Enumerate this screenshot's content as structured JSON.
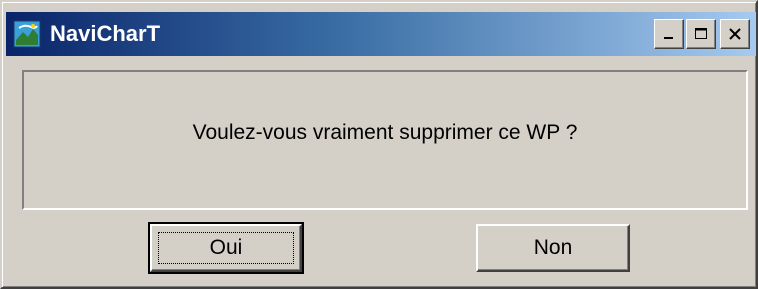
{
  "window": {
    "title": "NaviCharT",
    "icon": "navichart-app-icon",
    "controls": [
      "minimize-icon",
      "maximize-icon",
      "close-icon"
    ]
  },
  "dialog": {
    "message": "Voulez-vous vraiment supprimer ce WP ?"
  },
  "buttons": {
    "yes_label": "Oui",
    "no_label": "Non",
    "default": "yes"
  },
  "colors": {
    "titlebar_start": "#0a246a",
    "titlebar_end": "#a6caf0",
    "face": "#d4d0c8"
  }
}
